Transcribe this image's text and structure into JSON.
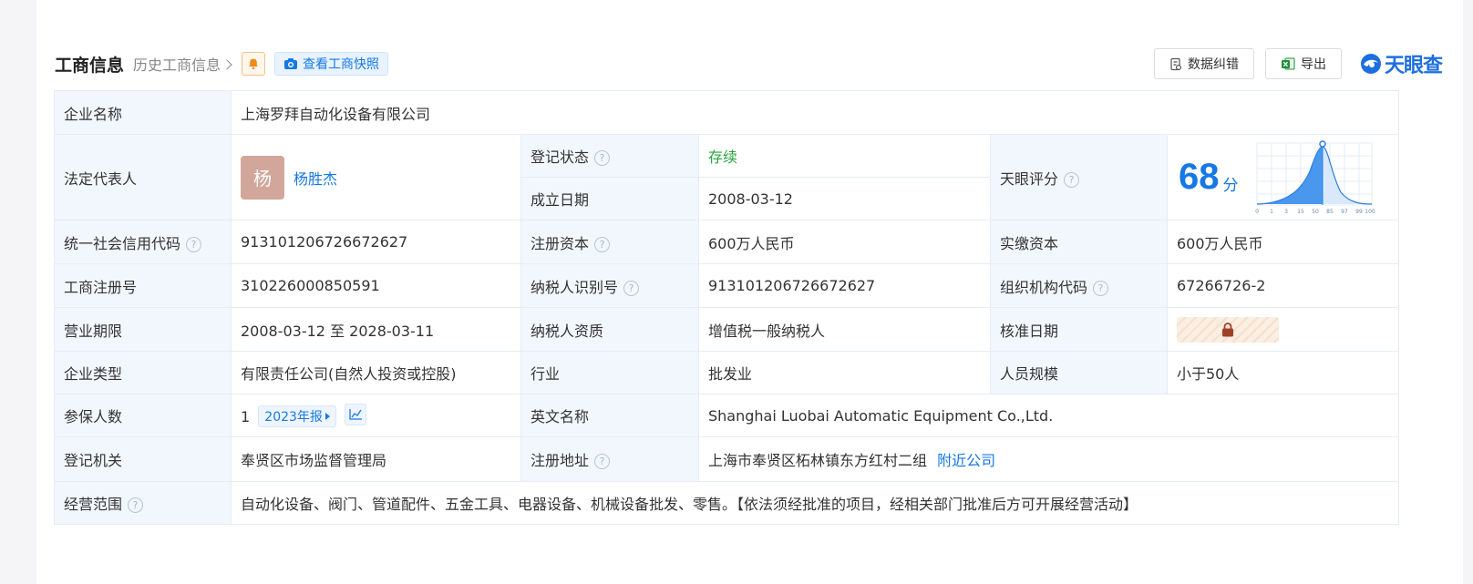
{
  "header": {
    "title": "工商信息",
    "history_label": "历史工商信息",
    "snapshot_label": "查看工商快照",
    "correct_label": "数据纠错",
    "export_label": "导出",
    "logo_text": "天眼查"
  },
  "q_mark": "?",
  "info": {
    "company_name_label": "企业名称",
    "company_name": "上海罗拜自动化设备有限公司",
    "legal_rep_label": "法定代表人",
    "avatar_char": "杨",
    "legal_rep": "杨胜杰",
    "reg_status_label": "登记状态",
    "reg_status": "存续",
    "found_date_label": "成立日期",
    "found_date": "2008-03-12",
    "score_label": "天眼评分",
    "score": "68",
    "score_unit": "分",
    "score_axis": [
      "0",
      "1",
      "3",
      "15",
      "50",
      "85",
      "97",
      "99",
      "100"
    ],
    "credit_code_label": "统一社会信用代码",
    "credit_code": "913101206726672627",
    "reg_capital_label": "注册资本",
    "reg_capital": "600万人民币",
    "paid_capital_label": "实缴资本",
    "paid_capital": "600万人民币",
    "reg_no_label": "工商注册号",
    "reg_no": "310226000850591",
    "taxpayer_id_label": "纳税人识别号",
    "taxpayer_id": "913101206726672627",
    "org_code_label": "组织机构代码",
    "org_code": "67266726-2",
    "term_label": "营业期限",
    "term": "2008-03-12 至 2028-03-11",
    "taxpayer_qual_label": "纳税人资质",
    "taxpayer_qual": "增值税一般纳税人",
    "approve_date_label": "核准日期",
    "type_label": "企业类型",
    "type": "有限责任公司(自然人投资或控股)",
    "industry_label": "行业",
    "industry": "批发业",
    "staff_label": "人员规模",
    "staff": "小于50人",
    "insured_label": "参保人数",
    "insured": "1",
    "insured_year": "2023年报",
    "en_name_label": "英文名称",
    "en_name": "Shanghai Luobai Automatic Equipment Co.,Ltd.",
    "authority_label": "登记机关",
    "authority": "奉贤区市场监督管理局",
    "address_label": "注册地址",
    "address": "上海市奉贤区柘林镇东方红村二组",
    "nearby_label": "附近公司",
    "scope_label": "经营范围",
    "scope": "自动化设备、阀门、管道配件、五金工具、电器设备、机械设备批发、零售。【依法须经批准的项目，经相关部门批准后方可开展经营活动】"
  }
}
